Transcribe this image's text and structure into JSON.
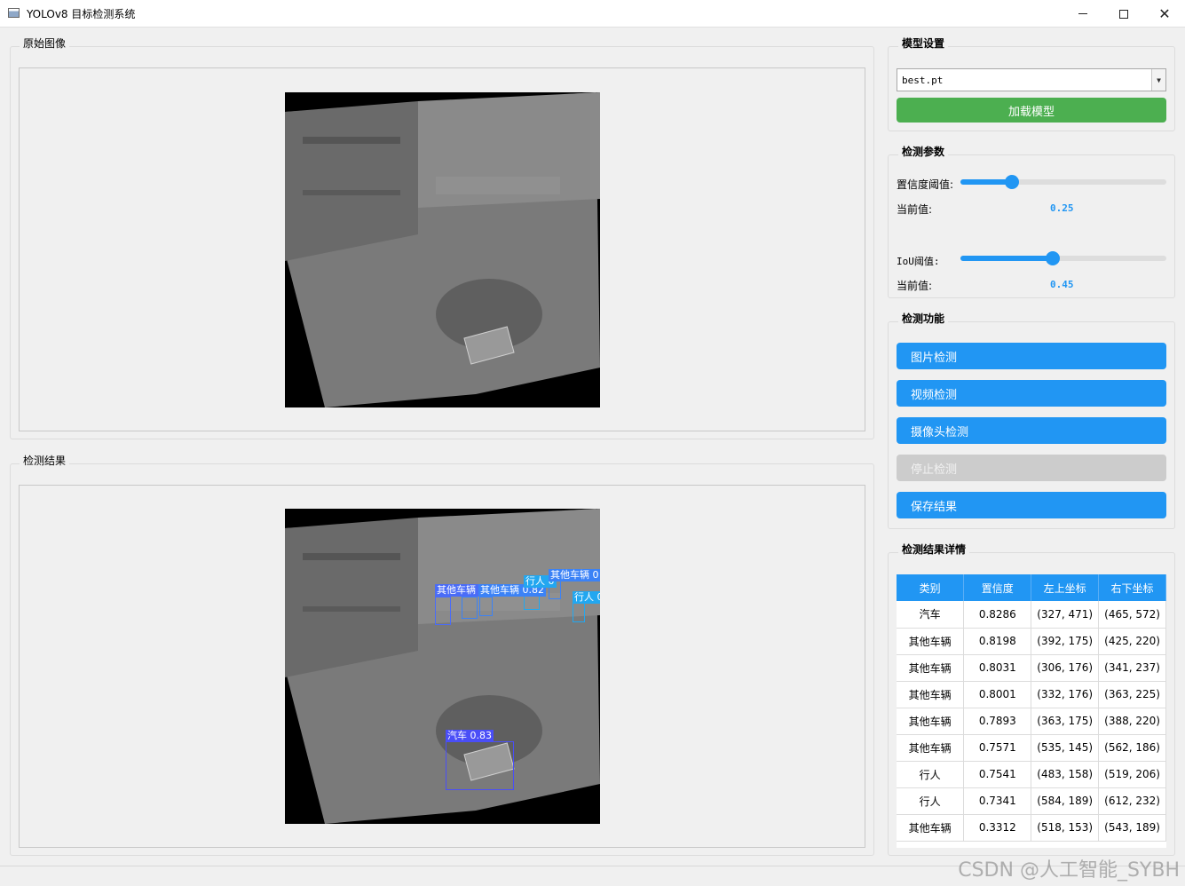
{
  "window": {
    "title": "YOLOv8 目标检测系统"
  },
  "original_panel": {
    "title": "原始图像"
  },
  "result_panel": {
    "title": "检测结果"
  },
  "model_settings": {
    "title": "模型设置",
    "model_file": "best.pt",
    "load_button": "加载模型"
  },
  "detection_params": {
    "title": "检测参数",
    "conf_label": "置信度阈值:",
    "conf_current_label": "当前值:",
    "conf_value": "0.25",
    "conf_fraction": 0.25,
    "iou_label": "IoU阈值:",
    "iou_current_label": "当前值:",
    "iou_value": "0.45",
    "iou_fraction": 0.45
  },
  "detection_functions": {
    "title": "检测功能",
    "image_button": "图片检测",
    "video_button": "视频检测",
    "camera_button": "摄像头检测",
    "stop_button": "停止检测",
    "save_button": "保存结果"
  },
  "results_detail": {
    "title": "检测结果详情",
    "columns": [
      "类别",
      "置信度",
      "左上坐标",
      "右下坐标"
    ],
    "rows": [
      [
        "汽车",
        "0.8286",
        "(327, 471)",
        "(465, 572)"
      ],
      [
        "其他车辆",
        "0.8198",
        "(392, 175)",
        "(425, 220)"
      ],
      [
        "其他车辆",
        "0.8031",
        "(306, 176)",
        "(341, 237)"
      ],
      [
        "其他车辆",
        "0.8001",
        "(332, 176)",
        "(363, 225)"
      ],
      [
        "其他车辆",
        "0.7893",
        "(363, 175)",
        "(388, 220)"
      ],
      [
        "其他车辆",
        "0.7571",
        "(535, 145)",
        "(562, 186)"
      ],
      [
        "行人",
        "0.7541",
        "(483, 158)",
        "(519, 206)"
      ],
      [
        "行人",
        "0.7341",
        "(584, 189)",
        "(612, 232)"
      ],
      [
        "其他车辆",
        "0.3312",
        "(518, 153)",
        "(543, 189)"
      ]
    ]
  },
  "detections_overlay": [
    {
      "label": "其他车辆 0",
      "color": "#4a6cf7"
    },
    {
      "label": "其他车辆 0.82",
      "color": "#3b82f6"
    },
    {
      "label": "行人 0",
      "color": "#22a7f0"
    },
    {
      "label": "其他车辆 0",
      "color": "#3b82f6"
    },
    {
      "label": "行人 0",
      "color": "#22a7f0"
    },
    {
      "label": "汽车 0.83",
      "color": "#4a4ef7"
    }
  ],
  "watermark": "CSDN @人工智能_SYBH"
}
